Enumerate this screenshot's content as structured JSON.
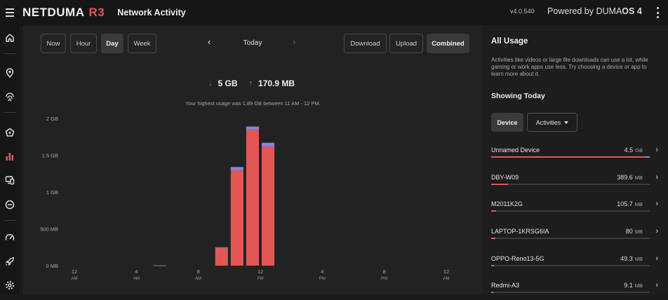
{
  "header": {
    "brand": "NETDUMA",
    "brand_model": "R3",
    "page_title": "Network Activity",
    "version": "v4.0.540",
    "powered_prefix": "Powered by DUMA",
    "powered_suffix": "OS 4"
  },
  "sidebar": {
    "icons": [
      "home-icon",
      "location-pin-icon",
      "fingerprint-icon",
      "pentagon-shield-icon",
      "bar-chart-icon",
      "devices-icon",
      "minus-circle-icon",
      "speedometer-icon",
      "rocket-icon",
      "settings-icon"
    ],
    "active": "bar-chart-icon",
    "accent": "#e25656"
  },
  "toolbar": {
    "ranges": [
      "Now",
      "Hour",
      "Day",
      "Week"
    ],
    "active_range": "Day",
    "date_label": "Today",
    "modes": [
      "Download",
      "Upload",
      "Combined"
    ],
    "active_mode": "Combined"
  },
  "totals": {
    "down_arrow": "↓",
    "up_arrow": "↑",
    "download": "5 GB",
    "upload": "170.9 MB"
  },
  "highest_text": "Your highest usage was 1.89 GB between 11 AM - 12 PM.",
  "chart_data": {
    "type": "bar",
    "stacked": true,
    "categories": [
      "12 AM",
      "1 AM",
      "2 AM",
      "3 AM",
      "4 AM",
      "5 AM",
      "6 AM",
      "7 AM",
      "8 AM",
      "9 AM",
      "10 AM",
      "11 AM",
      "12 PM",
      "1 PM",
      "2 PM",
      "3 PM",
      "4 PM",
      "5 PM",
      "6 PM",
      "7 PM",
      "8 PM",
      "9 PM",
      "10 PM",
      "11 PM"
    ],
    "series": [
      {
        "values": [
          0,
          0,
          0,
          0,
          0,
          0.005,
          0,
          0,
          0,
          0.24,
          1.3,
          1.85,
          1.62,
          0,
          0,
          0,
          0,
          0,
          0,
          0,
          0,
          0,
          0,
          0
        ],
        "color": "#e25656"
      },
      {
        "values": [
          0,
          0,
          0,
          0,
          0,
          0,
          0,
          0,
          0,
          0.01,
          0.04,
          0.04,
          0.05,
          0,
          0,
          0,
          0,
          0,
          0,
          0,
          0,
          0,
          0,
          0
        ],
        "color": "#7b86e8"
      }
    ],
    "y_ticks": [
      {
        "value": 0,
        "label": "0 MB"
      },
      {
        "value": 0.5,
        "label": "500 MB"
      },
      {
        "value": 1,
        "label": "1 GB"
      },
      {
        "value": 1.5,
        "label": "1.5 GB"
      },
      {
        "value": 2,
        "label": "2 GB"
      }
    ],
    "x_ticks": [
      {
        "index": 0,
        "label": "12",
        "sub": "AM"
      },
      {
        "index": 4,
        "label": "4",
        "sub": "AM"
      },
      {
        "index": 8,
        "label": "8",
        "sub": "AM"
      },
      {
        "index": 12,
        "label": "12",
        "sub": "PM"
      },
      {
        "index": 16,
        "label": "4",
        "sub": "PM"
      },
      {
        "index": 20,
        "label": "8",
        "sub": "PM"
      },
      {
        "index": 24,
        "label": "12",
        "sub": "AM"
      }
    ],
    "ylim": [
      0,
      2
    ],
    "grid": false
  },
  "panel": {
    "title": "All Usage",
    "description": "Activities like videos or large file downloads can use a lot, while gaming or work apps use less. Try choosing a device or app to learn more about it.",
    "showing": "Showing Today",
    "device_label": "Device",
    "activities_label": "Activities",
    "devices": [
      {
        "name": "Unnamed Device",
        "value": "4.5",
        "unit": "GB",
        "down": 0.97,
        "up": 0.03
      },
      {
        "name": "DBY-W09",
        "value": "389.6",
        "unit": "MB",
        "down": 0.1,
        "up": 0.006
      },
      {
        "name": "M2011K2G",
        "value": "105.7",
        "unit": "MB",
        "down": 0.025,
        "up": 0.004
      },
      {
        "name": "LAPTOP-1KRSG6IA",
        "value": "80",
        "unit": "MB",
        "down": 0.02,
        "up": 0.003
      },
      {
        "name": "OPPO-Reno13-5G",
        "value": "49.3",
        "unit": "MB",
        "down": 0.012,
        "up": 0.002
      },
      {
        "name": "Redmi-A3",
        "value": "9.1",
        "unit": "MB",
        "down": 0.004,
        "up": 0.001
      }
    ]
  }
}
